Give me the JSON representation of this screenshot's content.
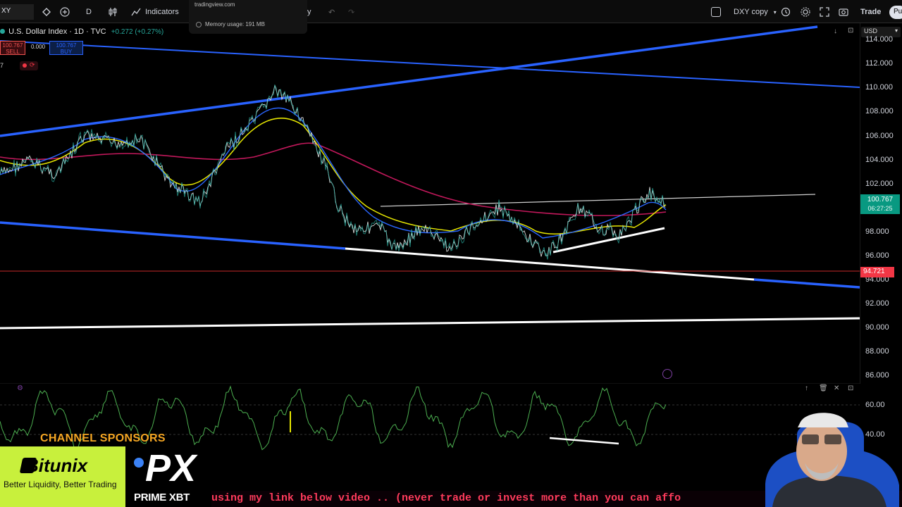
{
  "toolbar": {
    "symbol": "XY",
    "interval": "D",
    "indicators_label": "Indicators",
    "layout_name": "DXY copy",
    "trade_label": "Trade",
    "publish_label": "Pu",
    "partial_label": "y"
  },
  "tooltip": {
    "site": "tradingview.com",
    "memory": "Memory usage: 191 MB"
  },
  "legend": {
    "title": "U.S. Dollar Index · 1D · TVC",
    "change": "+0.272 (+0.27%)",
    "sell_price": "100.767",
    "sell_label": "SELL",
    "spread": "0.000",
    "buy_price": "100.767",
    "buy_label": "BUY",
    "indicator_count": "7"
  },
  "price_axis": {
    "currency": "USD",
    "labels": [
      "114.000",
      "112.000",
      "110.000",
      "108.000",
      "106.000",
      "104.000",
      "102.000",
      "98.000",
      "96.000",
      "94.000",
      "92.000",
      "90.000",
      "88.000",
      "86.000"
    ],
    "current_price": "100.767",
    "countdown": "06:27:25",
    "marked_level": "94.721"
  },
  "oscillator": {
    "labels": [
      "60.00",
      "40.00"
    ]
  },
  "sponsor": {
    "title": "CHANNEL SPONSORS",
    "bitunix_name": "Bitunix",
    "bitunix_tagline": "Better Liquidity, Better Trading",
    "px_logo": "PX",
    "px_name": "PRIME XBT"
  },
  "ticker": {
    "text": "using my link below video  .. (never trade or invest more than you can affo"
  },
  "colors": {
    "background": "#000000",
    "trendline_blue": "#2962ff",
    "candle_green": "#26a69a",
    "sponsor_orange": "#f5a623",
    "bitunix_lime": "#c8f03c",
    "ticker_red": "#ff3b5c",
    "current_price_green": "#089981",
    "level_red": "#f23645"
  }
}
